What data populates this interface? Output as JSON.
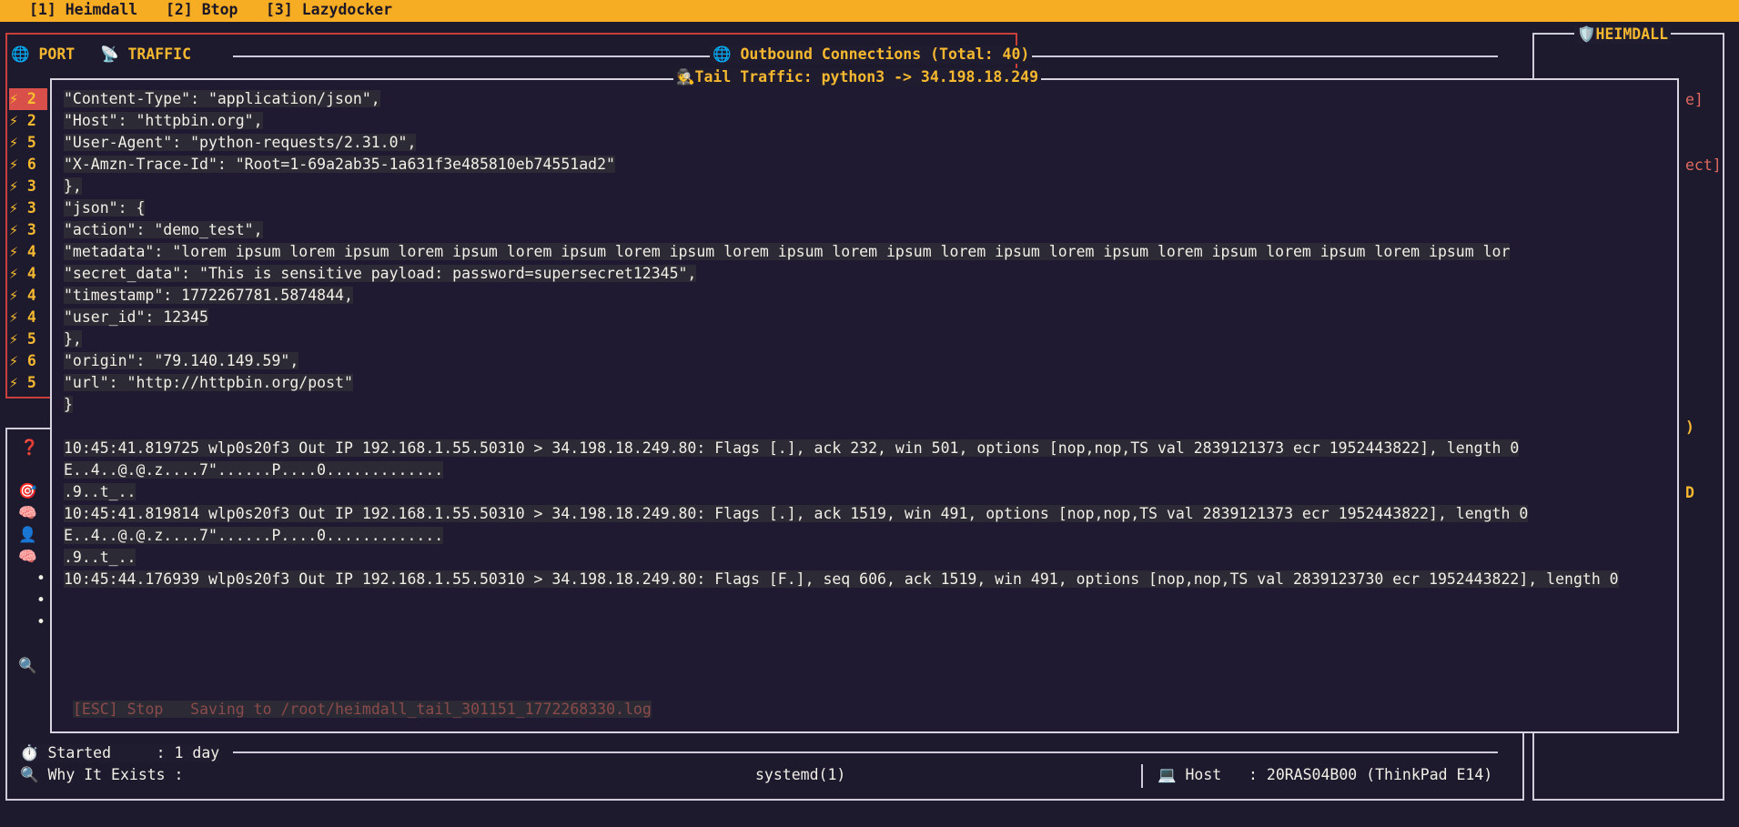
{
  "tabs": [
    "[1] Heimdall",
    "[2] Btop",
    "[3] Lazydocker"
  ],
  "left_panel": {
    "port_label": "🌐 PORT",
    "traffic_label": "📡 TRAFFIC",
    "rows": [
      "⚡ 2",
      "⚡ 2",
      "⚡ 5",
      "⚡ 6",
      "⚡ 3",
      "⚡ 3",
      "⚡ 3",
      "⚡ 4",
      "⚡ 4",
      "⚡ 4",
      "⚡ 4",
      "⚡ 5",
      "⚡ 6",
      "⚡ 5"
    ],
    "selected_index": 0,
    "side_icons": [
      "❓",
      "🎯",
      "🧠",
      "👤",
      "🧠",
      "•",
      "•",
      "•",
      "🔍"
    ]
  },
  "outbound_title": "🌐 Outbound Connections (Total: 40)",
  "right_panel": {
    "title": "🛡️HEIMDALL",
    "fragments": [
      "e]",
      "ect]",
      ")",
      "D"
    ]
  },
  "modal": {
    "title": "🕵️Tail Traffic: python3 -> 34.198.18.249",
    "lines": [
      "    \"Content-Type\": \"application/json\",",
      "    \"Host\": \"httpbin.org\",",
      "    \"User-Agent\": \"python-requests/2.31.0\",",
      "    \"X-Amzn-Trace-Id\": \"Root=1-69a2ab35-1a631f3e485810eb74551ad2\"",
      "  },",
      "  \"json\": {",
      "    \"action\": \"demo_test\",",
      "    \"metadata\": \"lorem ipsum lorem ipsum lorem ipsum lorem ipsum lorem ipsum lorem ipsum lorem ipsum lorem ipsum lorem ipsum lorem ipsum lorem ipsum lorem ipsum lor",
      "    \"secret_data\": \"This is sensitive payload: password=supersecret12345\",",
      "    \"timestamp\": 1772267781.5874844,",
      "    \"user_id\": 12345",
      "  },",
      "  \"origin\": \"79.140.149.59\",",
      "  \"url\": \"http://httpbin.org/post\"",
      "}",
      "",
      "10:45:41.819725 wlp0s20f3 Out IP 192.168.1.55.50310 > 34.198.18.249.80: Flags [.], ack 232, win 501, options [nop,nop,TS val 2839121373 ecr 1952443822], length 0",
      "E..4..@.@.z....7\"......P....0.............",
      ".9..t_..",
      "10:45:41.819814 wlp0s20f3 Out IP 192.168.1.55.50310 > 34.198.18.249.80: Flags [.], ack 1519, win 491, options [nop,nop,TS val 2839121373 ecr 1952443822], length 0",
      "E..4..@.@.z....7\"......P....0.............",
      ".9..t_..",
      "10:45:44.176939 wlp0s20f3 Out IP 192.168.1.55.50310 > 34.198.18.249.80: Flags [F.], seq 606, ack 1519, win 491, options [nop,nop,TS val 2839123730 ecr 1952443822], length 0"
    ],
    "footer": "[ESC] Stop   Saving to /root/heimdall_tail_301151_1772268330.log"
  },
  "status": {
    "started_label": "⏱️ Started     : 1 day",
    "why_label": "🔍 Why It Exists :",
    "why_value": "systemd(1)",
    "host_label": "💻 Host   : 20RAS04B00 (ThinkPad E14)"
  }
}
